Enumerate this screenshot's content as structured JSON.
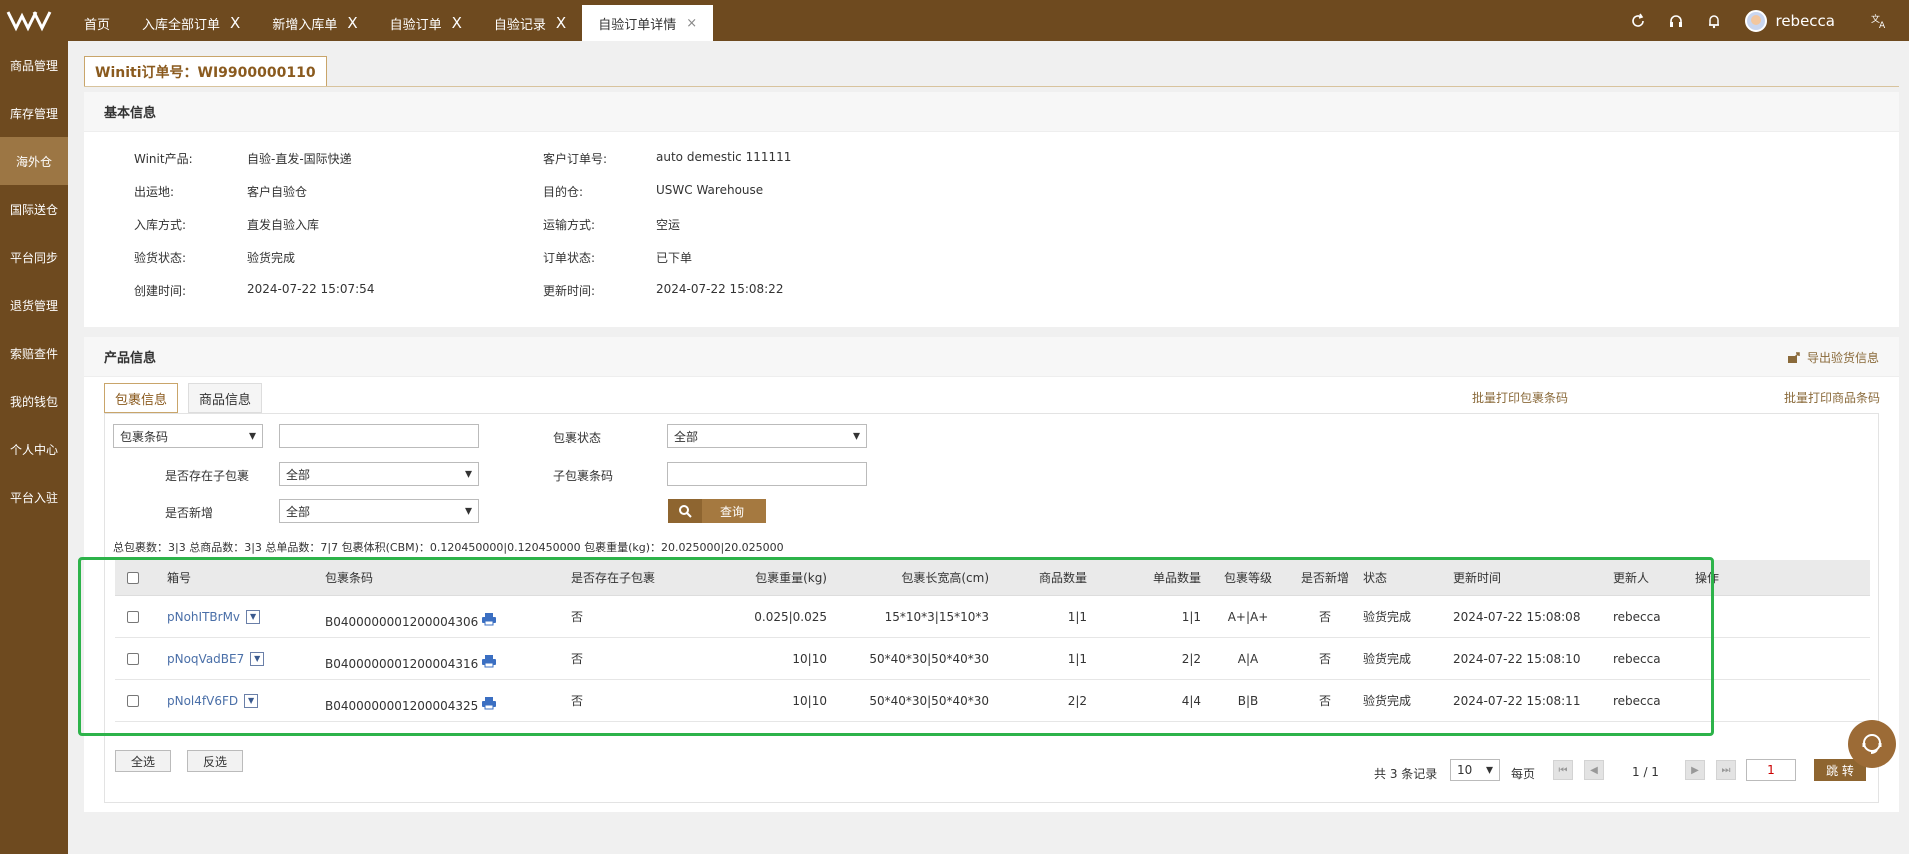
{
  "topbar": {
    "tabs": [
      {
        "label": "首页",
        "closable": false,
        "active": false
      },
      {
        "label": "入库全部订单",
        "closable": true,
        "active": false
      },
      {
        "label": "新增入库单",
        "closable": true,
        "active": false
      },
      {
        "label": "自验订单",
        "closable": true,
        "active": false
      },
      {
        "label": "自验记录",
        "closable": true,
        "active": false
      },
      {
        "label": "自验订单详情",
        "closable": true,
        "active": true
      }
    ],
    "close_glyph": "X",
    "close_glyph_active": "×",
    "icons": [
      "refresh-icon",
      "headset-icon",
      "bell-icon"
    ],
    "username": "rebecca",
    "lang_icon": "translate-icon"
  },
  "sidebar": {
    "items": [
      "商品管理",
      "库存管理",
      "海外仓",
      "国际送仓",
      "平台同步",
      "退货管理",
      "索赔查件",
      "我的钱包",
      "个人中心",
      "平台入驻"
    ],
    "active_index": 2
  },
  "order_title": "Winiti订单号：WI9900000110",
  "basic": {
    "title": "基本信息",
    "left": [
      {
        "label": "Winit产品:",
        "value": "自验-直发-国际快递"
      },
      {
        "label": "出运地:",
        "value": "客户自验仓"
      },
      {
        "label": "入库方式:",
        "value": "直发自验入库"
      },
      {
        "label": "验货状态:",
        "value": "验货完成"
      },
      {
        "label": "创建时间:",
        "value": "2024-07-22 15:07:54"
      }
    ],
    "right": [
      {
        "label": "客户订单号:",
        "value": "auto demestic 111111"
      },
      {
        "label": "目的仓:",
        "value": "USWC Warehouse"
      },
      {
        "label": "运输方式:",
        "value": "空运"
      },
      {
        "label": "订单状态:",
        "value": "已下单"
      },
      {
        "label": "更新时间:",
        "value": "2024-07-22 15:08:22"
      }
    ]
  },
  "product": {
    "title": "产品信息",
    "export_label": "导出验货信息",
    "subtabs": [
      "包裹信息",
      "商品信息"
    ],
    "batch_print_package": "批量打印包裹条码",
    "batch_print_product": "批量打印商品条码",
    "filters": {
      "barcode_select": "包裹条码",
      "barcode_input": "",
      "package_status_label": "包裹状态",
      "package_status_value": "全部",
      "has_sub_label": "是否存在子包裹",
      "has_sub_value": "全部",
      "sub_barcode_label": "子包裹条码",
      "sub_barcode_value": "",
      "is_new_label": "是否新增",
      "is_new_value": "全部",
      "query_label": "查询"
    },
    "summary": "总包裹数：3|3    总商品数：3|3    总单品数：7|7    包裹体积(CBM)：0.120450000|0.120450000    包裹重量(kg)：20.025000|20.025000",
    "table": {
      "headers": [
        "箱号",
        "包裹条码",
        "是否存在子包裹",
        "包裹重量(kg)",
        "包裹长宽高(cm)",
        "商品数量",
        "单品数量",
        "包裹等级",
        "是否新增",
        "状态",
        "更新时间",
        "更新人",
        "操作"
      ],
      "rows": [
        {
          "box": "pNohITBrMv",
          "barcode": "B0400000001200004306",
          "has_sub": "否",
          "weight": "0.025|0.025",
          "dims": "15*10*3|15*10*3",
          "qty": "1|1",
          "units": "1|1",
          "grade": "A+|A+",
          "is_new": "否",
          "status": "验货完成",
          "updated": "2024-07-22 15:08:08",
          "updater": "rebecca"
        },
        {
          "box": "pNoqVadBE7",
          "barcode": "B0400000001200004316",
          "has_sub": "否",
          "weight": "10|10",
          "dims": "50*40*30|50*40*30",
          "qty": "1|1",
          "units": "2|2",
          "grade": "A|A",
          "is_new": "否",
          "status": "验货完成",
          "updated": "2024-07-22 15:08:10",
          "updater": "rebecca"
        },
        {
          "box": "pNol4fV6FD",
          "barcode": "B0400000001200004325",
          "has_sub": "否",
          "weight": "10|10",
          "dims": "50*40*30|50*40*30",
          "qty": "2|2",
          "units": "4|4",
          "grade": "B|B",
          "is_new": "否",
          "status": "验货完成",
          "updated": "2024-07-22 15:08:11",
          "updater": "rebecca"
        }
      ]
    },
    "select_all": "全选",
    "invert": "反选",
    "pager": {
      "total_text": "共 3 条记录",
      "page_size": "10",
      "per_page": "每页",
      "page_info": "1 / 1",
      "page_input": "1",
      "jump_label": "跳 转"
    }
  },
  "colors": {
    "brand": "#6e4a1f",
    "accent": "#a57940",
    "highlight": "#2db34a",
    "link": "#4a6fa8"
  }
}
